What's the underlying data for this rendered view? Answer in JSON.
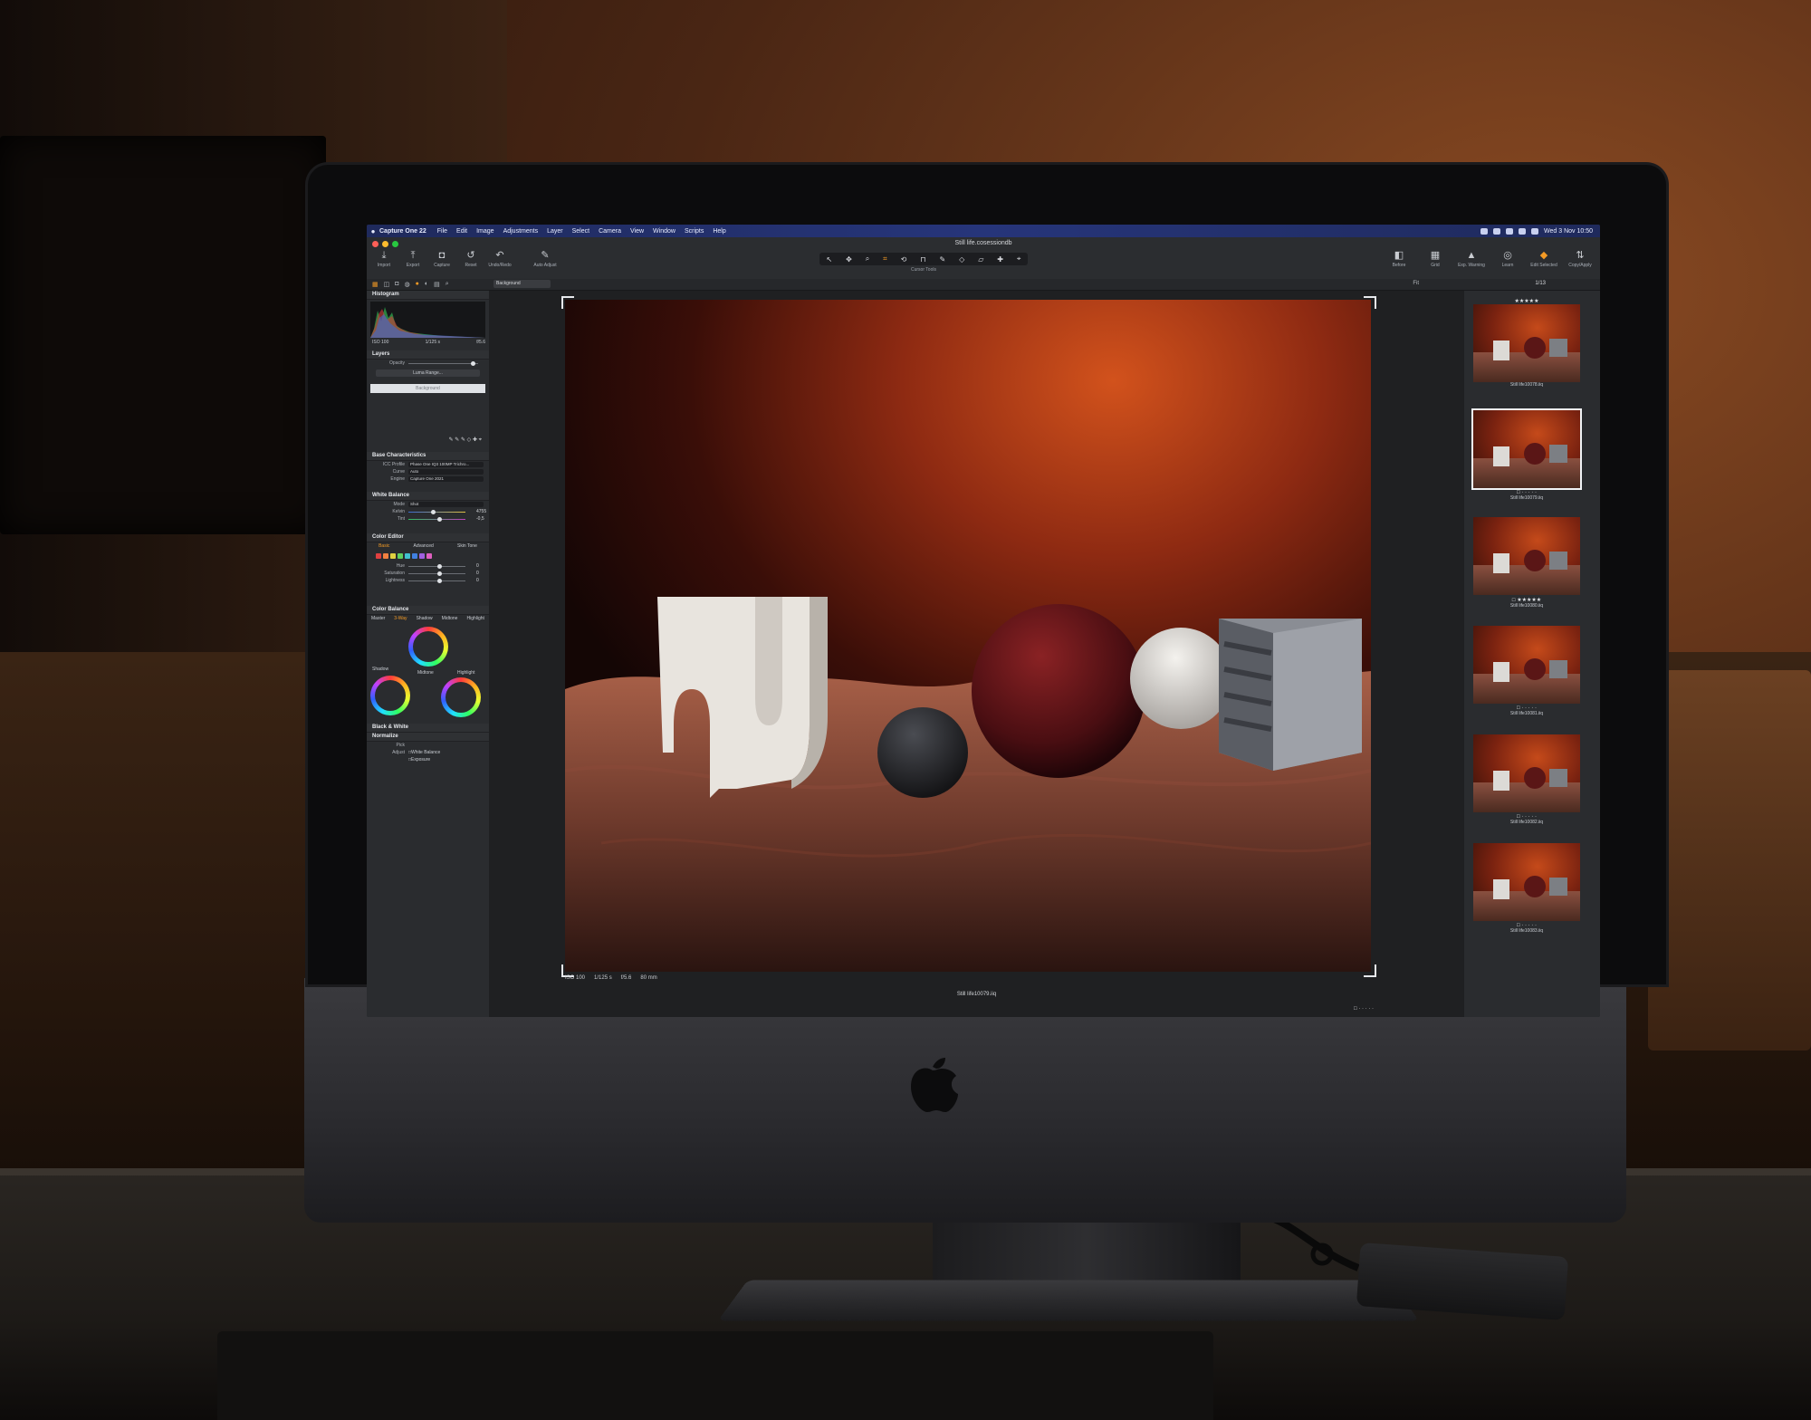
{
  "menubar": {
    "app_name": "Capture One 22",
    "items": [
      "File",
      "Edit",
      "Image",
      "Adjustments",
      "Layer",
      "Select",
      "Camera",
      "View",
      "Window",
      "Scripts",
      "Help"
    ],
    "clock": "Wed 3 Nov 10:50"
  },
  "window": {
    "title": "Still life.cosessiondb"
  },
  "toolbar_left": [
    {
      "icon": "import-icon",
      "label": "Import"
    },
    {
      "icon": "export-icon",
      "label": "Export"
    },
    {
      "icon": "capture-icon",
      "label": "Capture"
    },
    {
      "icon": "reset-icon",
      "label": "Reset"
    },
    {
      "icon": "undo-redo-icon",
      "label": "Undo/Redo"
    },
    {
      "icon": "auto-adjust-icon",
      "label": "Auto Adjust"
    }
  ],
  "cursor_tools_label": "Cursor Tools",
  "toolbar_right": [
    {
      "icon": "before-icon",
      "label": "Before"
    },
    {
      "icon": "grid-icon",
      "label": "Grid"
    },
    {
      "icon": "exposure-warning-icon",
      "label": "Exp. Warning"
    },
    {
      "icon": "learn-icon",
      "label": "Learn"
    },
    {
      "icon": "edit-selected-icon",
      "label": "Edit Selected"
    },
    {
      "icon": "copy-apply-icon",
      "label": "Copy/Apply"
    }
  ],
  "subbar": {
    "layer_select": "Background",
    "fit": "Fit",
    "count": "1/13"
  },
  "histogram": {
    "title": "Histogram",
    "iso": "ISO 100",
    "shutter": "1/125 s",
    "aperture": "f/5.6"
  },
  "layers": {
    "title": "Layers",
    "opacity_label": "Opacity",
    "luma_range": "Luma Range...",
    "background_layer": "Background"
  },
  "base_characteristics": {
    "title": "Base Characteristics",
    "icc_label": "ICC Profile",
    "icc_value": "Phase One IQ3 100MP Trichro...",
    "curve_label": "Curve",
    "curve_value": "Auto",
    "engine_label": "Engine",
    "engine_value": "Capture One 2021"
  },
  "white_balance": {
    "title": "White Balance",
    "mode_label": "Mode",
    "mode_value": "Shot",
    "kelvin_label": "Kelvin",
    "kelvin_value": "4755",
    "tint_label": "Tint",
    "tint_value": "-0,5"
  },
  "color_editor": {
    "title": "Color Editor",
    "tabs": [
      "Basic",
      "Advanced",
      "Skin Tone"
    ],
    "hue_label": "Hue",
    "hue_value": "0",
    "saturation_label": "Saturation",
    "saturation_value": "0",
    "lightness_label": "Lightness",
    "lightness_value": "0"
  },
  "color_balance": {
    "title": "Color Balance",
    "tabs": [
      "Master",
      "3-Way",
      "Shadow",
      "Midtone",
      "Highlight"
    ],
    "shadow_label": "Shadow",
    "midtone_label": "Midtone",
    "highlight_label": "Highlight"
  },
  "black_white": {
    "title": "Black & White"
  },
  "normalize": {
    "title": "Normalize",
    "pick_label": "Pick",
    "adjust_label": "Adjust",
    "white_balance_label": "White Balance",
    "exposure_label": "Exposure"
  },
  "viewer": {
    "meta": [
      "ISO 100",
      "1/125 s",
      "f/5.6",
      "80 mm"
    ],
    "filename": "Still life10079.iiq",
    "rating": "□ · · · · ·"
  },
  "filmstrip": [
    {
      "name": "Still life10078.iiq",
      "stars": "★★★★★"
    },
    {
      "name": "Still life10079.iiq",
      "stars": "□ · · · · ·"
    },
    {
      "name": "Still life10080.iiq",
      "stars": "□ ★★★★★"
    },
    {
      "name": "Still life10081.iiq",
      "stars": "□ · · · · ·"
    },
    {
      "name": "Still life10082.iiq",
      "stars": "□ · · · · ·"
    },
    {
      "name": "Still life10083.iiq",
      "stars": "□ · · · · ·"
    }
  ],
  "colors": {
    "accent": "#f39a25",
    "menubar": "#26357a",
    "panel": "#2a2c2f"
  }
}
